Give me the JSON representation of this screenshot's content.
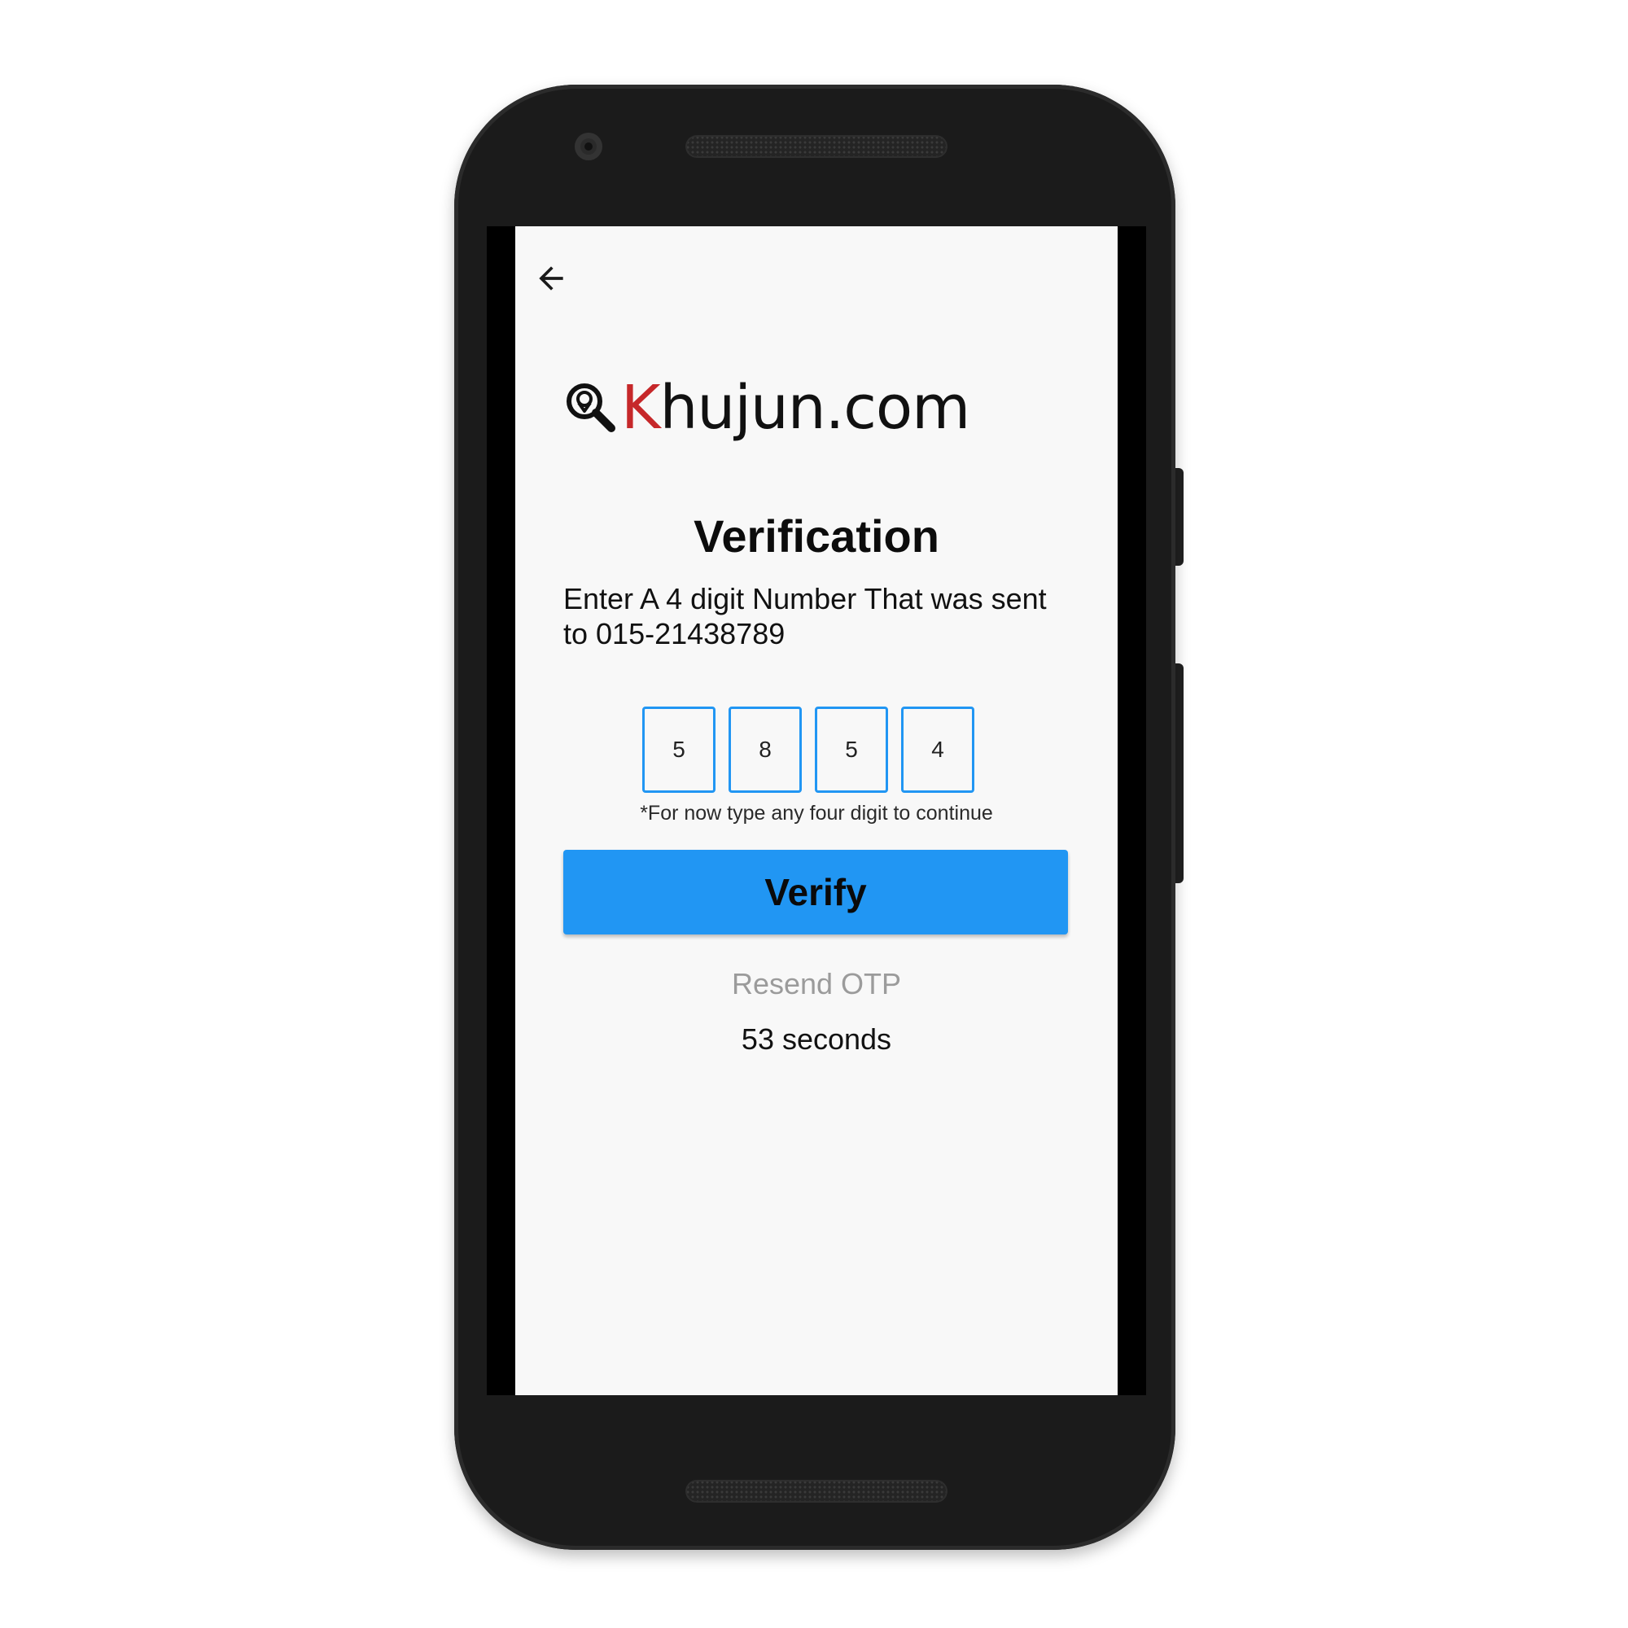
{
  "brand": {
    "k_letter": "K",
    "rest": "hujun.com",
    "icon": "search-pin-icon"
  },
  "header": {
    "back_icon": "arrow-left-icon"
  },
  "verification": {
    "title": "Verification",
    "subtitle": "Enter A 4 digit Number That was sent to 015-21438789",
    "otp_digits": [
      "5",
      "8",
      "5",
      "4"
    ],
    "hint": "*For now type any four digit to continue",
    "verify_label": "Verify",
    "resend_label": "Resend OTP",
    "timer": "53 seconds"
  },
  "colors": {
    "accent": "#2196f3",
    "brand_red": "#c6282a",
    "disabled_text": "#9b9b9b",
    "screen_bg": "#f8f8f8",
    "phone_body": "#1b1b1b"
  }
}
